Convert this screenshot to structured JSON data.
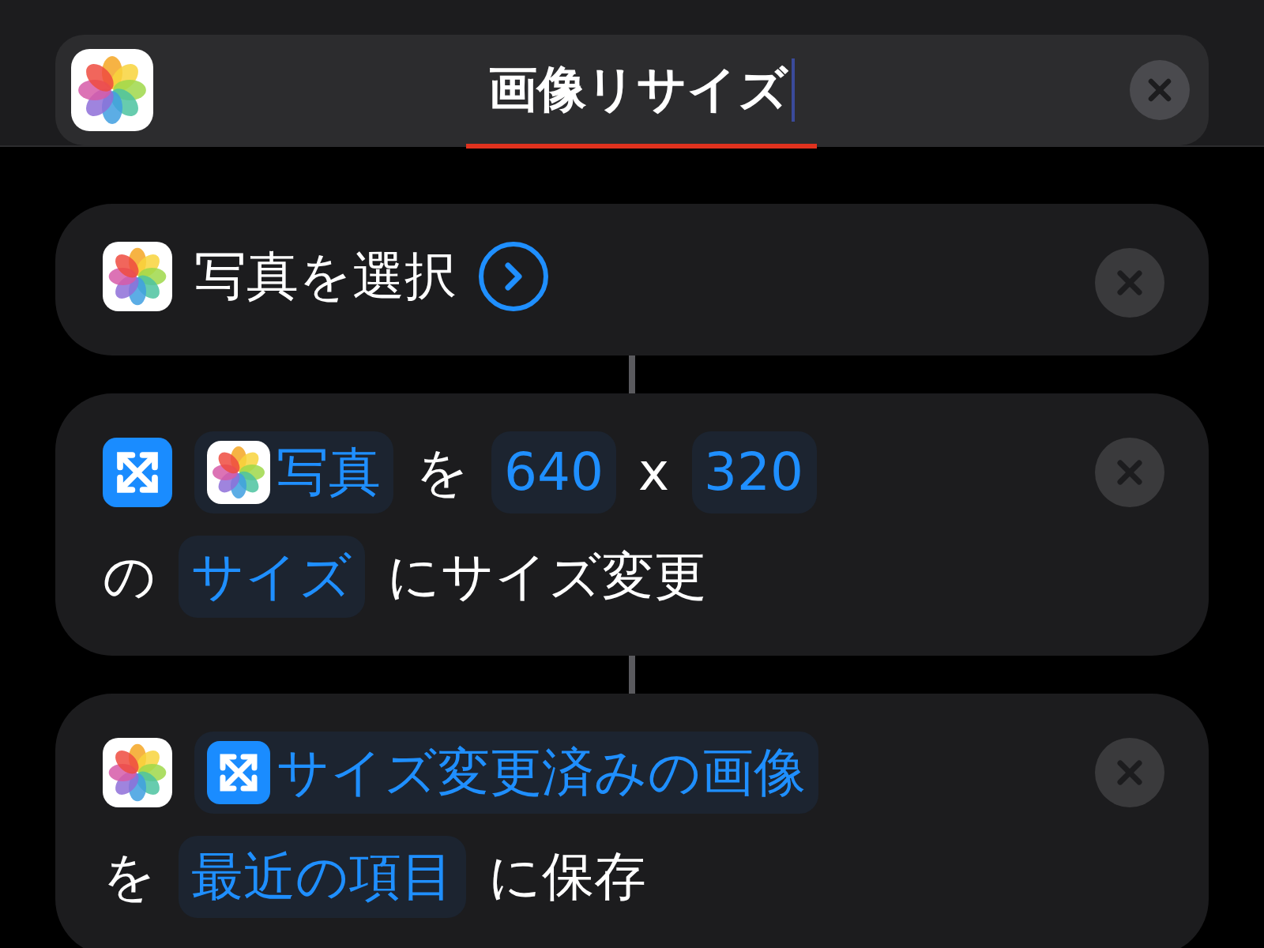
{
  "header": {
    "title": "画像リサイズ",
    "spellcheck": true,
    "cursor": true
  },
  "actions": [
    {
      "kind": "photos",
      "lines": [
        [
          {
            "kind": "text",
            "text": "写真を選択"
          },
          {
            "kind": "chevron"
          }
        ]
      ]
    },
    {
      "kind": "resize",
      "lines": [
        [
          {
            "kind": "photos_variable",
            "text": "写真"
          },
          {
            "kind": "text",
            "text": "を"
          },
          {
            "kind": "param",
            "text": "640"
          },
          {
            "kind": "text",
            "text": "x"
          },
          {
            "kind": "param",
            "text": "320"
          }
        ],
        [
          {
            "kind": "text",
            "text": "の"
          },
          {
            "kind": "param",
            "text": "サイズ"
          },
          {
            "kind": "text",
            "text": "にサイズ変更"
          }
        ]
      ]
    },
    {
      "kind": "photos",
      "lines": [
        [
          {
            "kind": "resize_variable",
            "text": "サイズ変更済みの画像"
          }
        ],
        [
          {
            "kind": "text",
            "text": "を"
          },
          {
            "kind": "param",
            "text": "最近の項目"
          },
          {
            "kind": "text",
            "text": "に保存"
          }
        ]
      ]
    }
  ]
}
